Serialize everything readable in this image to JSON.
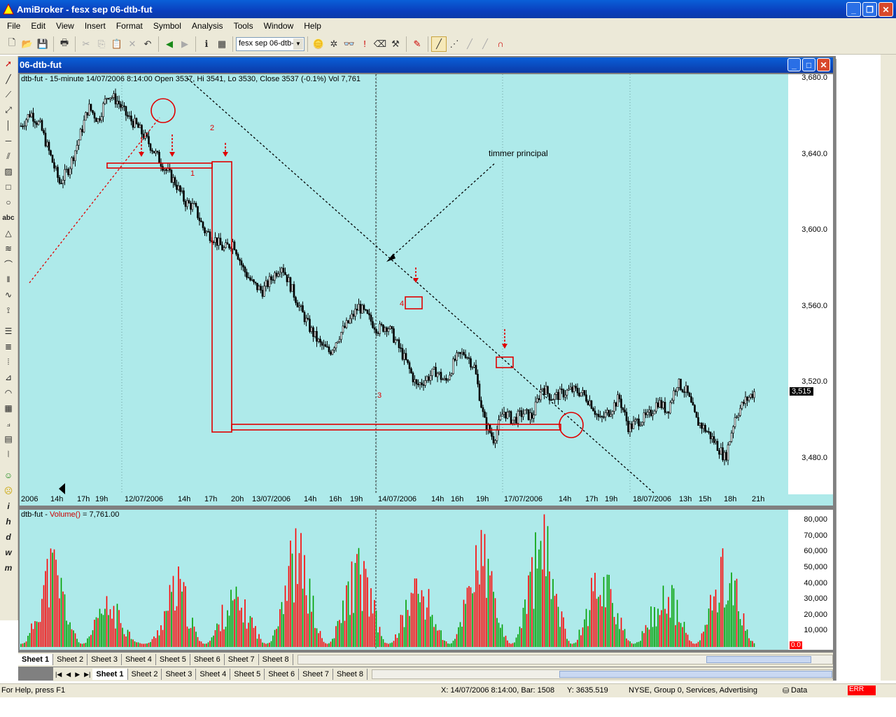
{
  "app": {
    "title": "AmiBroker - fesx sep 06-dtb-fut"
  },
  "menu": [
    {
      "label": "File"
    },
    {
      "label": "Edit"
    },
    {
      "label": "View"
    },
    {
      "label": "Insert"
    },
    {
      "label": "Format"
    },
    {
      "label": "Symbol"
    },
    {
      "label": "Analysis"
    },
    {
      "label": "Tools"
    },
    {
      "label": "Window"
    },
    {
      "label": "Help"
    }
  ],
  "toolbar": {
    "symbol_value": "fesx sep 06-dtb-"
  },
  "chart_window": {
    "title": "06-dtb-fut"
  },
  "price_pane": {
    "header": "dtb-fut - 15-minute 14/07/2006 8:14:00 Open 3537, Hi 3541, Lo 3530, Close 3537 (-0.1%) Vol 7,761",
    "y_ticks": [
      "3,680.0",
      "3,640.0",
      "3,600.0",
      "3,560.0",
      "3,520.0",
      "3,480.0"
    ],
    "last_price_badge": "3,515",
    "x_ticks": [
      "2006",
      "14h",
      "17h",
      "19h",
      "12/07/2006",
      "14h",
      "17h",
      "20h",
      "13/07/2006",
      "14h",
      "16h",
      "19h",
      "14/07/2006",
      "14h",
      "16h",
      "19h",
      "17/07/2006",
      "14h",
      "17h",
      "19h",
      "18/07/2006",
      "13h",
      "15h",
      "18h",
      "21h"
    ],
    "annotations": {
      "label_1": "1",
      "label_2": "2",
      "label_3": "3",
      "label_4": "4",
      "text_note": "timmer principal"
    }
  },
  "volume_pane": {
    "header_prefix": "dtb-fut - ",
    "header_func": "Volume()",
    "header_suffix": " = 7,761.00",
    "y_ticks": [
      "80,000",
      "70,000",
      "60,000",
      "50,000",
      "40,000",
      "30,000",
      "20,000",
      "10,000"
    ],
    "last_badge": "0.0"
  },
  "chart_data": [
    {
      "type": "candlestick",
      "title": "",
      "ylim": [
        3470,
        3680
      ],
      "x_session_labels": [
        "2006",
        "12/07/2006",
        "13/07/2006",
        "14/07/2006",
        "17/07/2006",
        "18/07/2006"
      ],
      "approx_close_path": [
        3655,
        3662,
        3655,
        3640,
        3625,
        3633,
        3648,
        3665,
        3658,
        3672,
        3668,
        3660,
        3655,
        3648,
        3640,
        3632,
        3625,
        3615,
        3612,
        3600,
        3596,
        3590,
        3594,
        3580,
        3572,
        3568,
        3575,
        3582,
        3570,
        3558,
        3548,
        3540,
        3536,
        3545,
        3552,
        3560,
        3554,
        3548,
        3550,
        3540,
        3530,
        3518,
        3522,
        3526,
        3520,
        3532,
        3536,
        3528,
        3500,
        3490,
        3505,
        3500,
        3504,
        3502,
        3518,
        3512,
        3514,
        3516,
        3515,
        3510,
        3500,
        3505,
        3512,
        3496,
        3500,
        3502,
        3510,
        3505,
        3520,
        3515,
        3500,
        3495,
        3488,
        3480,
        3502,
        3510,
        3515
      ]
    },
    {
      "type": "bar",
      "title": "",
      "ylim": [
        0,
        85000
      ],
      "up_color": "#00a000",
      "down_color": "#ff0000",
      "approx_volume_peaks": [
        38000,
        62000,
        47000,
        25000,
        12000,
        50000,
        40000,
        32000,
        72000,
        68000,
        54000,
        60000,
        48000,
        39000,
        74000,
        65000,
        73000,
        82000,
        55000,
        46000,
        34000,
        52000,
        60000,
        50000
      ]
    }
  ],
  "sheet_tabs_top": [
    "Sheet 1",
    "Sheet 2",
    "Sheet 3",
    "Sheet 4",
    "Sheet 5",
    "Sheet 6",
    "Sheet 7",
    "Sheet 8"
  ],
  "sheet_tabs_bottom": [
    "Sheet 1",
    "Sheet 2",
    "Sheet 3",
    "Sheet 4",
    "Sheet 5",
    "Sheet 6",
    "Sheet 7",
    "Sheet 8"
  ],
  "status": {
    "help": "For Help, press F1",
    "xy": "X: 14/07/2006 8:14:00, Bar: 1508",
    "y": "Y: 3635.519",
    "exchange": "NYSE, Group 0, Services, Advertising",
    "data": "Data",
    "err": "ERR"
  },
  "colors": {
    "pane_bg": "#aeeaea",
    "annotation": "#ff0000",
    "title_bar": "#0a5fd8"
  }
}
